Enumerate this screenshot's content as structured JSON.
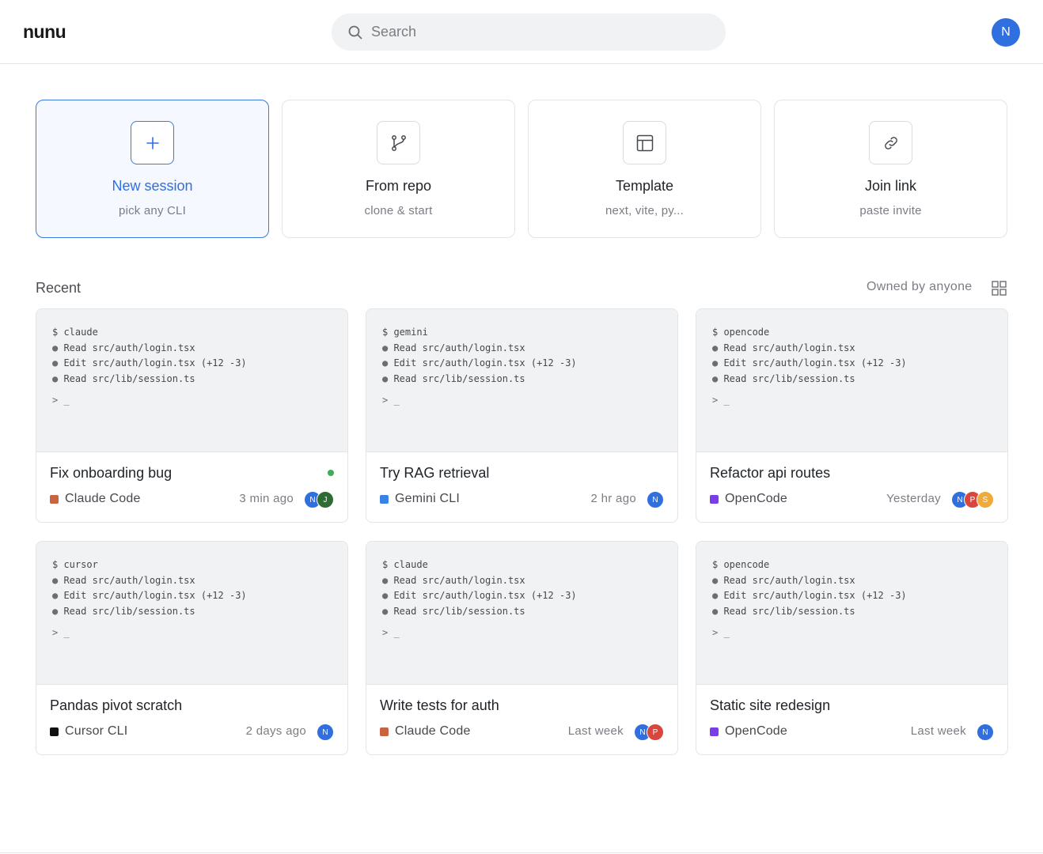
{
  "header": {
    "logo": "nunu",
    "search_placeholder": "Search",
    "user_initial": "N",
    "user_color": "#2f6fe0"
  },
  "actions": [
    {
      "title": "New session",
      "subtitle": "pick any CLI",
      "icon": "plus-icon"
    },
    {
      "title": "From repo",
      "subtitle": "clone & start",
      "icon": "git-branch-icon"
    },
    {
      "title": "Template",
      "subtitle": "next, vite, py...",
      "icon": "layout-template-icon"
    },
    {
      "title": "Join link",
      "subtitle": "paste invite",
      "icon": "link-icon"
    }
  ],
  "recent": {
    "label": "Recent",
    "owner_filter": "Owned by anyone",
    "view_icon": "grid-view-icon"
  },
  "sessions": [
    {
      "command": "$ claude",
      "lines": [
        "Read src/auth/login.tsx",
        "Edit src/auth/login.tsx (+12 -3)",
        "Read src/lib/session.ts"
      ],
      "prompt": "> _",
      "title": "Fix onboarding bug",
      "tool": "Claude Code",
      "tool_color": "#c8643f",
      "time": "3 min ago",
      "live": true,
      "avatars": [
        {
          "initial": "N",
          "color": "#2f6fe0"
        },
        {
          "initial": "J",
          "color": "#2e6b35"
        }
      ]
    },
    {
      "command": "$ gemini",
      "lines": [
        "Read src/auth/login.tsx",
        "Edit src/auth/login.tsx (+12 -3)",
        "Read src/lib/session.ts"
      ],
      "prompt": "> _",
      "title": "Try RAG retrieval",
      "tool": "Gemini CLI",
      "tool_color": "#3b82e6",
      "time": "2 hr ago",
      "live": false,
      "avatars": [
        {
          "initial": "N",
          "color": "#2f6fe0"
        }
      ]
    },
    {
      "command": "$ opencode",
      "lines": [
        "Read src/auth/login.tsx",
        "Edit src/auth/login.tsx (+12 -3)",
        "Read src/lib/session.ts"
      ],
      "prompt": "> _",
      "title": "Refactor api routes",
      "tool": "OpenCode",
      "tool_color": "#7a3ee6",
      "time": "Yesterday",
      "live": false,
      "avatars": [
        {
          "initial": "N",
          "color": "#2f6fe0"
        },
        {
          "initial": "P",
          "color": "#d9463e"
        },
        {
          "initial": "S",
          "color": "#f0a93b"
        }
      ]
    },
    {
      "command": "$ cursor",
      "lines": [
        "Read src/auth/login.tsx",
        "Edit src/auth/login.tsx (+12 -3)",
        "Read src/lib/session.ts"
      ],
      "prompt": "> _",
      "title": "Pandas pivot scratch",
      "tool": "Cursor CLI",
      "tool_color": "#111111",
      "time": "2 days ago",
      "live": false,
      "avatars": [
        {
          "initial": "N",
          "color": "#2f6fe0"
        }
      ]
    },
    {
      "command": "$ claude",
      "lines": [
        "Read src/auth/login.tsx",
        "Edit src/auth/login.tsx (+12 -3)",
        "Read src/lib/session.ts"
      ],
      "prompt": "> _",
      "title": "Write tests for auth",
      "tool": "Claude Code",
      "tool_color": "#c8643f",
      "time": "Last week",
      "live": false,
      "avatars": [
        {
          "initial": "N",
          "color": "#2f6fe0"
        },
        {
          "initial": "P",
          "color": "#d9463e"
        }
      ]
    },
    {
      "command": "$ opencode",
      "lines": [
        "Read src/auth/login.tsx",
        "Edit src/auth/login.tsx (+12 -3)",
        "Read src/lib/session.ts"
      ],
      "prompt": "> _",
      "title": "Static site redesign",
      "tool": "OpenCode",
      "tool_color": "#7a3ee6",
      "time": "Last week",
      "live": false,
      "avatars": [
        {
          "initial": "N",
          "color": "#2f6fe0"
        }
      ]
    }
  ]
}
